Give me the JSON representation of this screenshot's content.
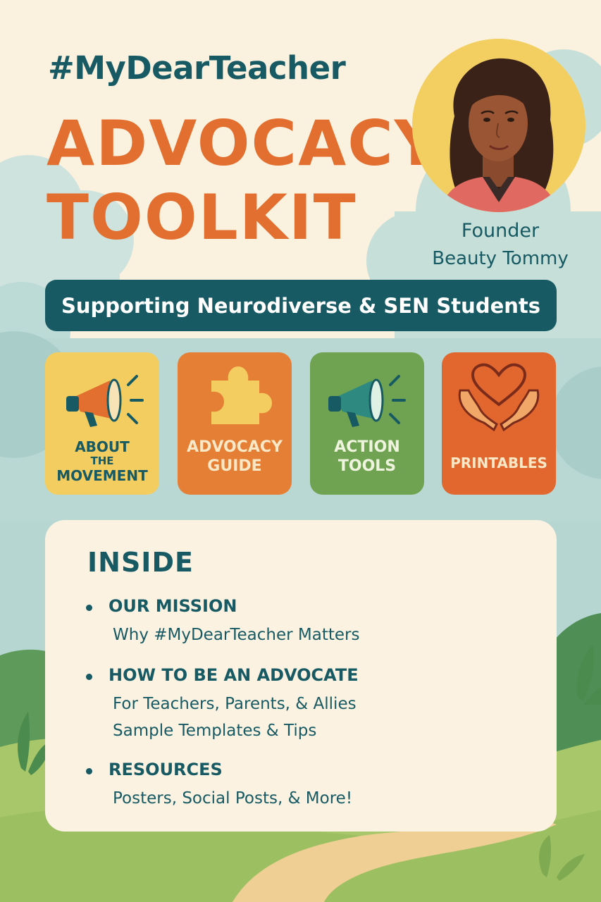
{
  "header": {
    "hashtag": "#MyDearTeacher",
    "title_line1": "ADVOCACY",
    "title_line2": "TOOLKIT"
  },
  "founder": {
    "role": "Founder",
    "name": "Beauty Tommy"
  },
  "banner": {
    "text": "Supporting Neurodiverse & SEN Students"
  },
  "cards": [
    {
      "icon": "megaphone-icon",
      "line1": "ABOUT",
      "line2": "THE",
      "line3": "MOVEMENT",
      "color": "#f3cd60"
    },
    {
      "icon": "puzzle-piece-icon",
      "line1": "ADVOCACY",
      "line2": "GUIDE",
      "color": "#e57f35"
    },
    {
      "icon": "megaphone-icon",
      "line1": "ACTION",
      "line2": "TOOLS",
      "color": "#6fa352"
    },
    {
      "icon": "heart-in-hands-icon",
      "line1": "PRINTABLES",
      "color": "#e2672f"
    }
  ],
  "inside": {
    "title": "INSIDE",
    "items": [
      {
        "heading": "OUR MISSION",
        "lines": [
          "Why #MyDearTeacher Matters"
        ]
      },
      {
        "heading": "HOW TO BE AN ADVOCATE",
        "lines": [
          "For Teachers, Parents, & Allies",
          "Sample Templates & Tips"
        ]
      },
      {
        "heading": "RESOURCES",
        "lines": [
          "Posters, Social Posts, & More!"
        ]
      }
    ]
  },
  "colors": {
    "teal": "#175a63",
    "orange": "#e26f2f",
    "cream": "#fbf1df",
    "yellow": "#f3cd60",
    "green": "#6fa352"
  }
}
